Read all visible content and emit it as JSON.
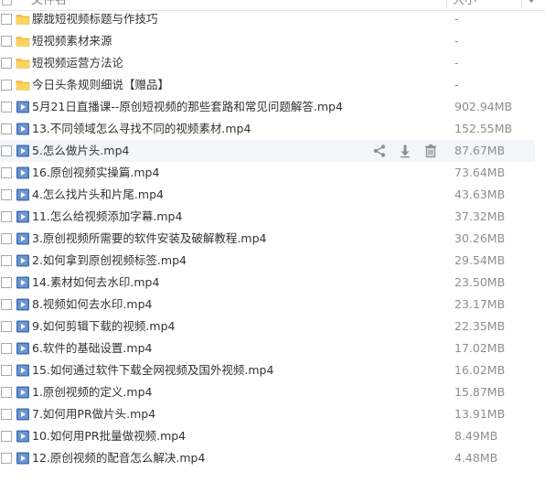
{
  "header": {
    "name_label": "文件名",
    "size_label": "大小"
  },
  "rows": [
    {
      "type": "folder",
      "name": "朦胧短视频标题与作技巧",
      "size": "-"
    },
    {
      "type": "folder",
      "name": "短视频素材来源",
      "size": "-"
    },
    {
      "type": "folder",
      "name": "短视频运营方法论",
      "size": "-"
    },
    {
      "type": "folder",
      "name": "今日头条规则细说【赠品】",
      "size": "-"
    },
    {
      "type": "video",
      "name": "5月21日直播课--原创短视频的那些套路和常见问题解答.mp4",
      "size": "902.94MB"
    },
    {
      "type": "video",
      "name": "13.不同领域怎么寻找不同的视频素材.mp4",
      "size": "152.55MB"
    },
    {
      "type": "video",
      "name": "5.怎么做片头.mp4",
      "size": "87.67MB",
      "hover": true
    },
    {
      "type": "video",
      "name": "16.原创视频实操篇.mp4",
      "size": "73.64MB"
    },
    {
      "type": "video",
      "name": "4.怎么找片头和片尾.mp4",
      "size": "43.63MB"
    },
    {
      "type": "video",
      "name": "11.怎么给视频添加字幕.mp4",
      "size": "37.32MB"
    },
    {
      "type": "video",
      "name": "3.原创视频所需要的软件安装及破解教程.mp4",
      "size": "30.26MB"
    },
    {
      "type": "video",
      "name": "2.如何拿到原创视频标签.mp4",
      "size": "29.54MB"
    },
    {
      "type": "video",
      "name": "14.素材如何去水印.mp4",
      "size": "23.50MB"
    },
    {
      "type": "video",
      "name": "8.视频如何去水印.mp4",
      "size": "23.17MB"
    },
    {
      "type": "video",
      "name": "9.如何剪辑下载的视频.mp4",
      "size": "22.35MB"
    },
    {
      "type": "video",
      "name": "6.软件的基础设置.mp4",
      "size": "17.02MB"
    },
    {
      "type": "video",
      "name": "15.如何通过软件下载全网视频及国外视频.mp4",
      "size": "16.02MB"
    },
    {
      "type": "video",
      "name": "1.原创视频的定义.mp4",
      "size": "15.87MB"
    },
    {
      "type": "video",
      "name": "7.如何用PR做片头.mp4",
      "size": "13.91MB"
    },
    {
      "type": "video",
      "name": "10.如何用PR批量做视频.mp4",
      "size": "8.49MB"
    },
    {
      "type": "video",
      "name": "12.原创视频的配音怎么解决.mp4",
      "size": "4.48MB"
    }
  ],
  "row_actions": [
    {
      "icon": "share-icon"
    },
    {
      "icon": "download-icon"
    },
    {
      "icon": "delete-icon"
    }
  ],
  "colors": {
    "folder": "#f7c23f",
    "video": "#3f6fb5",
    "hover_row": "#f2f6fb",
    "action_icon": "#8a8f98"
  }
}
